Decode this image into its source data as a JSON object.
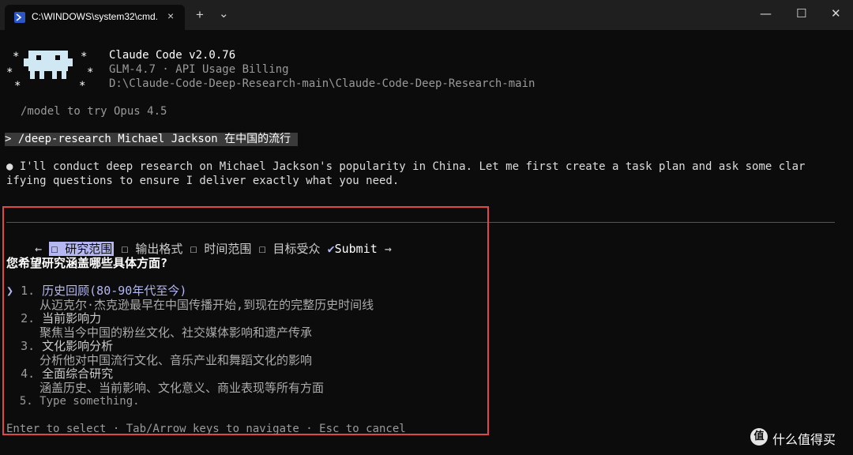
{
  "window": {
    "tab_title": "C:\\WINDOWS\\system32\\cmd.",
    "tab_close": "×",
    "new_tab": "+",
    "dropdown": "⌄",
    "minimize": "—",
    "maximize": "☐",
    "close": "✕"
  },
  "header": {
    "app_name": "Claude Code v2.0.76",
    "billing": "GLM-4.7 · API Usage Billing",
    "path": "D:\\Claude-Code-Deep-Research-main\\Claude-Code-Deep-Research-main",
    "hint": "/model to try Opus 4.5"
  },
  "prompt": {
    "command": "> /deep-research Michael Jackson 在中国的流行 "
  },
  "response": {
    "line1": "● I'll conduct deep research on Michael Jackson's popularity in China. Let me first create a task plan and ask some clar",
    "line2": "ifying questions to ensure I deliver exactly what you need."
  },
  "question_tabs": {
    "left_arrow": "←",
    "tabs": [
      {
        "label": "☐ 研究范围"
      },
      {
        "label": "☐ 输出格式"
      },
      {
        "label": "☐ 时间范围"
      },
      {
        "label": "☐ 目标受众"
      }
    ],
    "submit_check": "✔",
    "submit_label": "Submit",
    "right_arrow": "→"
  },
  "question": "您希望研究涵盖哪些具体方面?",
  "options": [
    {
      "cursor": "❯",
      "number": "1.",
      "title": "历史回顾(80-90年代至今)",
      "desc": "从迈克尔·杰克逊最早在中国传播开始,到现在的完整历史时间线"
    },
    {
      "number": "2.",
      "title": "当前影响力",
      "desc": "聚焦当今中国的粉丝文化、社交媒体影响和遗产传承"
    },
    {
      "number": "3.",
      "title": "文化影响分析",
      "desc": "分析他对中国流行文化、音乐产业和舞蹈文化的影响"
    },
    {
      "number": "4.",
      "title": "全面综合研究",
      "desc": "涵盖历史、当前影响、文化意义、商业表现等所有方面"
    },
    {
      "number": "5.",
      "title": "Type something."
    }
  ],
  "footer": "Enter to select · Tab/Arrow keys to navigate · Esc to cancel",
  "watermark": {
    "logo": "值",
    "text": "什么值得买"
  },
  "colors": {
    "background": "#0c0c0c",
    "text": "#cccccc",
    "accent": "#b4b7f1",
    "highlight_box": "#e04848"
  }
}
